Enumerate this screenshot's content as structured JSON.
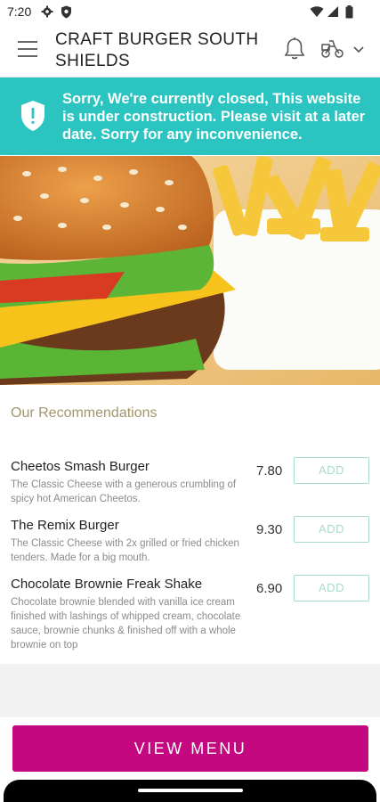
{
  "status_bar": {
    "time": "7:20",
    "icons": [
      "gear-icon",
      "shield-icon",
      "wifi-icon",
      "signal-icon",
      "battery-icon"
    ]
  },
  "header": {
    "title": "CRAFT BURGER SOUTH SHIELDS",
    "icons": [
      "menu-icon",
      "bell-icon",
      "scooter-icon",
      "chevron-down-icon"
    ]
  },
  "banner": {
    "message": "Sorry, We're currently closed, This website is under construction. Please visit at a later date. Sorry for any inconvenience.",
    "icon": "shield-alert-icon",
    "color": "#2cc4c0"
  },
  "recommendations": {
    "title": "Our Recommendations",
    "add_label": "ADD",
    "items": [
      {
        "name": "Cheetos Smash Burger",
        "description": "The Classic Cheese with a generous crumbling of spicy hot American Cheetos.",
        "price": "7.80"
      },
      {
        "name": "The Remix Burger",
        "description": "The Classic Cheese with 2x grilled or fried chicken tenders. Made for a big mouth.",
        "price": "9.30"
      },
      {
        "name": "Chocolate Brownie Freak Shake",
        "description": "Chocolate brownie blended with vanilla ice cream finished with lashings of whipped cream, chocolate sauce, brownie chunks & finished off with a whole brownie on top",
        "price": "6.90"
      }
    ]
  },
  "footer": {
    "view_menu_label": "VIEW MENU",
    "button_color": "#c4087f"
  }
}
